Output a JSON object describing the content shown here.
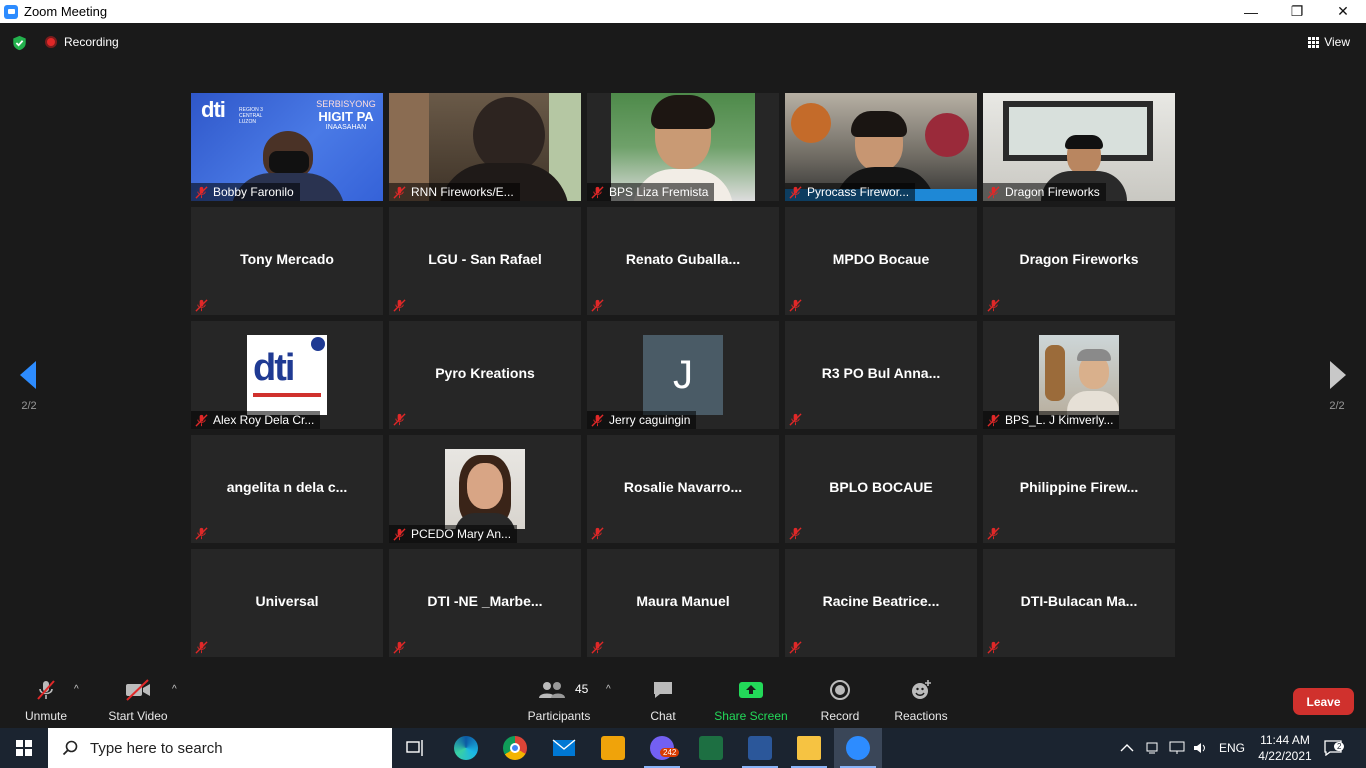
{
  "window": {
    "title": "Zoom Meeting",
    "minimize_glyph": "—",
    "restore_glyph": "❐",
    "close_glyph": "✕"
  },
  "topbar": {
    "recording_label": "Recording",
    "view_label": "View",
    "security_icon": "shield-check-icon"
  },
  "nav": {
    "left_page": "2/2",
    "right_page": "2/2"
  },
  "tiles": [
    {
      "name": "Bobby Faronilo",
      "kind": "video"
    },
    {
      "name": "RNN Fireworks/E...",
      "kind": "video"
    },
    {
      "name": "BPS Liza Fremista",
      "kind": "video"
    },
    {
      "name": "Pyrocass Firewor...",
      "kind": "video"
    },
    {
      "name": "Dragon Fireworks",
      "kind": "video"
    },
    {
      "name": "Tony Mercado",
      "kind": "text"
    },
    {
      "name": "LGU - San Rafael",
      "kind": "text"
    },
    {
      "name": "Renato  Guballa...",
      "kind": "text"
    },
    {
      "name": "MPDO Bocaue",
      "kind": "text"
    },
    {
      "name": "Dragon Fireworks",
      "kind": "text"
    },
    {
      "name": "Alex Roy Dela Cr...",
      "kind": "avatar",
      "avatar": "dti-logo"
    },
    {
      "name": "Pyro Kreations",
      "kind": "text"
    },
    {
      "name": "Jerry caguingin",
      "kind": "avatar",
      "avatar": "J"
    },
    {
      "name": "R3  PO Bul Anna...",
      "kind": "text"
    },
    {
      "name": "BPS_L. J Kimverly...",
      "kind": "avatar",
      "avatar": "photo"
    },
    {
      "name": "angelita  n  dela  c...",
      "kind": "text"
    },
    {
      "name": "PCEDO Mary An...",
      "kind": "avatar",
      "avatar": "photo"
    },
    {
      "name": "Rosalie  Navarro...",
      "kind": "text"
    },
    {
      "name": "BPLO BOCAUE",
      "kind": "text"
    },
    {
      "name": "Philippine  Firew...",
      "kind": "text"
    },
    {
      "name": "Universal",
      "kind": "text"
    },
    {
      "name": "DTI  -NE  _Marbe...",
      "kind": "text"
    },
    {
      "name": "Maura Manuel",
      "kind": "text"
    },
    {
      "name": "Racine  Beatrice...",
      "kind": "text"
    },
    {
      "name": "DTI-Bulacan  Ma...",
      "kind": "text"
    }
  ],
  "dti_tile": {
    "logo_text": "dti",
    "region_text": "REGION 3 CENTRAL LUZON",
    "banner_line1": "SERBISYONG",
    "banner_line2": "HIGIT PA",
    "banner_line3": "INAASAHAN"
  },
  "toolbar": {
    "unmute": "Unmute",
    "start_video": "Start Video",
    "participants": "Participants",
    "participant_count": "45",
    "chat": "Chat",
    "share_screen": "Share Screen",
    "record": "Record",
    "reactions": "Reactions",
    "leave": "Leave",
    "caret": "^"
  },
  "taskbar": {
    "search_placeholder": "Type here to search",
    "language": "ENG",
    "time": "11:44 AM",
    "date": "4/22/2021",
    "viber_badge": "242",
    "notifications_badge": "2"
  },
  "colors": {
    "accent": "#2d8cff",
    "share_green": "#23d959",
    "leave_red": "#d0312d",
    "muted_red": "#e02828"
  }
}
